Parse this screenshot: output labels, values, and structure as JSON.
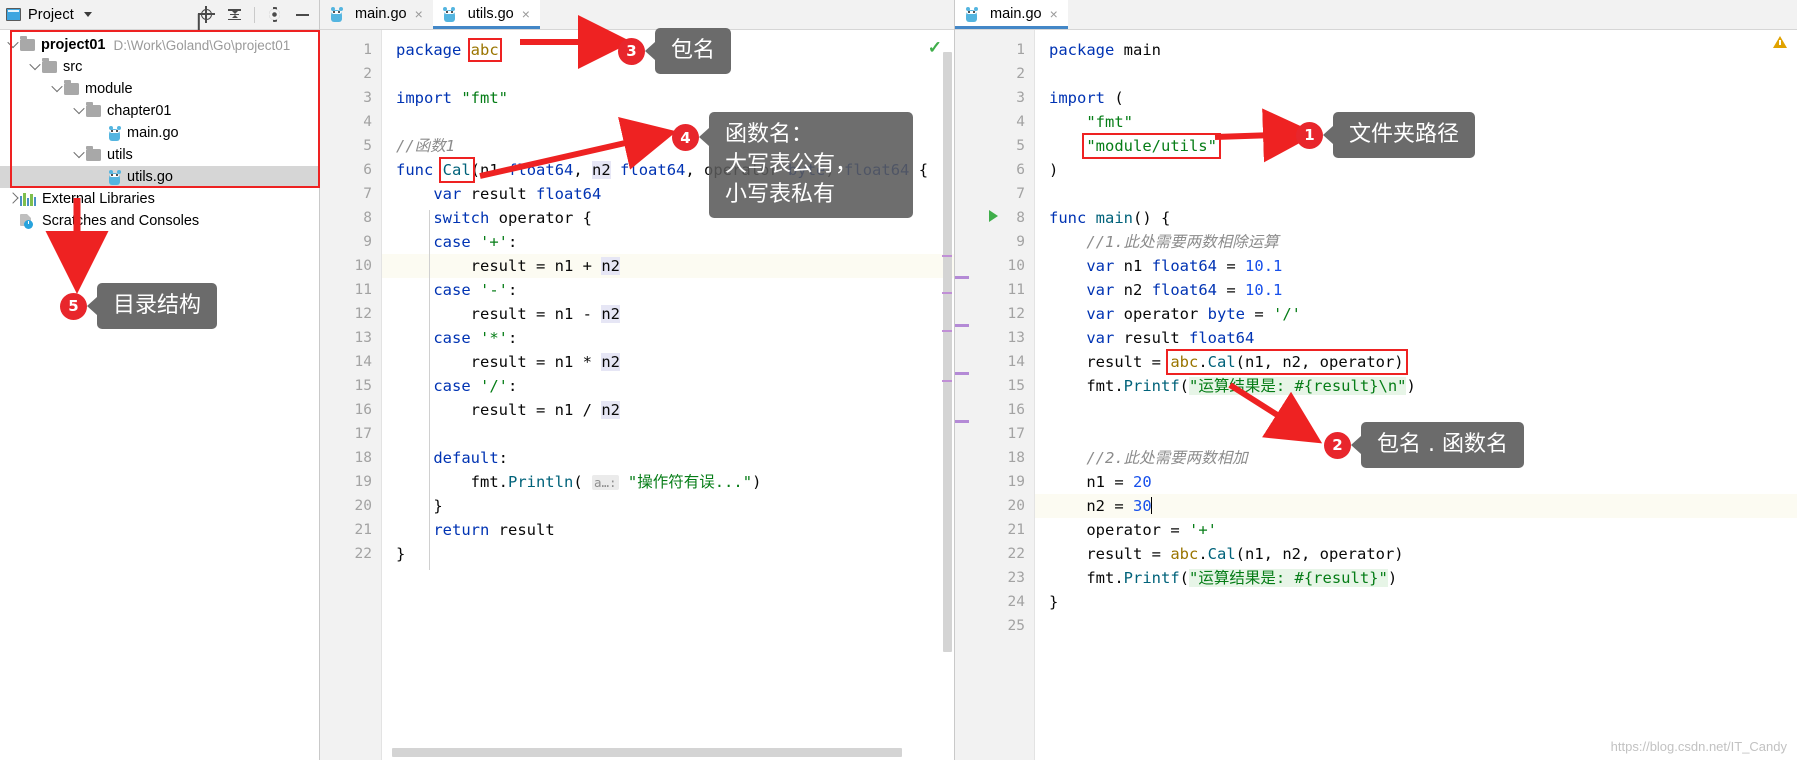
{
  "project_panel": {
    "title": "Project",
    "icons": [
      "project-icon",
      "caret-down-icon",
      "locate-target-icon",
      "collapse-all-icon",
      "settings-gear-icon",
      "minimize-icon"
    ],
    "tree": [
      {
        "label": "project01",
        "path": "D:\\Work\\Goland\\Go\\project01",
        "icon": "folder",
        "expanded": true,
        "depth": 0,
        "bold": true,
        "selected": false
      },
      {
        "label": "src",
        "path": "",
        "icon": "folder",
        "expanded": true,
        "depth": 1,
        "bold": false,
        "selected": false
      },
      {
        "label": "module",
        "path": "",
        "icon": "folder",
        "expanded": true,
        "depth": 2,
        "bold": false,
        "selected": false
      },
      {
        "label": "chapter01",
        "path": "",
        "icon": "folder",
        "expanded": true,
        "depth": 3,
        "bold": false,
        "selected": false
      },
      {
        "label": "main.go",
        "path": "",
        "icon": "go-file",
        "expanded": null,
        "depth": 4,
        "bold": false,
        "selected": false
      },
      {
        "label": "utils",
        "path": "",
        "icon": "folder",
        "expanded": true,
        "depth": 3,
        "bold": false,
        "selected": false
      },
      {
        "label": "utils.go",
        "path": "",
        "icon": "go-file",
        "expanded": null,
        "depth": 4,
        "bold": false,
        "selected": true
      },
      {
        "label": "External Libraries",
        "path": "",
        "icon": "libraries",
        "expanded": false,
        "depth": 0,
        "bold": false,
        "selected": false
      },
      {
        "label": "Scratches and Consoles",
        "path": "",
        "icon": "scratches",
        "expanded": null,
        "depth": 0,
        "bold": false,
        "selected": false
      }
    ]
  },
  "left_editor": {
    "tabs": [
      {
        "label": "main.go",
        "icon": "go-file-icon",
        "active": false,
        "close": "×"
      },
      {
        "label": "utils.go",
        "icon": "go-file-icon",
        "active": true,
        "close": "×"
      }
    ],
    "lines": [
      {
        "n": "1",
        "text": "package abc"
      },
      {
        "n": "2",
        "text": ""
      },
      {
        "n": "3",
        "text": "import \"fmt\""
      },
      {
        "n": "4",
        "text": ""
      },
      {
        "n": "5",
        "text": "//函数1"
      },
      {
        "n": "6",
        "text": "func Cal(n1 float64, n2 float64, operator byte) float64 {"
      },
      {
        "n": "7",
        "text": "    var result float64"
      },
      {
        "n": "8",
        "text": "    switch operator {"
      },
      {
        "n": "9",
        "text": "    case '+':"
      },
      {
        "n": "10",
        "text": "        result = n1 + n2"
      },
      {
        "n": "11",
        "text": "    case '-':"
      },
      {
        "n": "12",
        "text": "        result = n1 - n2"
      },
      {
        "n": "13",
        "text": "    case '*':"
      },
      {
        "n": "14",
        "text": "        result = n1 * n2"
      },
      {
        "n": "15",
        "text": "    case '/':"
      },
      {
        "n": "16",
        "text": "        result = n1 / n2"
      },
      {
        "n": "17",
        "text": ""
      },
      {
        "n": "18",
        "text": "    default:"
      },
      {
        "n": "19",
        "text": "        fmt.Println( a…: \"操作符有误...\")"
      },
      {
        "n": "20",
        "text": "    }"
      },
      {
        "n": "21",
        "text": "    return result"
      },
      {
        "n": "22",
        "text": "}"
      }
    ],
    "highlight_line": "10",
    "hint_arg": "a…:",
    "status_icon": "checkmark-ok-icon"
  },
  "right_editor": {
    "tabs": [
      {
        "label": "main.go",
        "icon": "go-file-icon",
        "active": true,
        "close": "×"
      }
    ],
    "lines": [
      {
        "n": "1",
        "text": "package main"
      },
      {
        "n": "2",
        "text": ""
      },
      {
        "n": "3",
        "text": "import ("
      },
      {
        "n": "4",
        "text": "    \"fmt\""
      },
      {
        "n": "5",
        "text": "    \"module/utils\""
      },
      {
        "n": "6",
        "text": ")"
      },
      {
        "n": "7",
        "text": ""
      },
      {
        "n": "8",
        "text": "func main() {"
      },
      {
        "n": "9",
        "text": "    //1.此处需要两数相除运算"
      },
      {
        "n": "10",
        "text": "    var n1 float64 = 10.1"
      },
      {
        "n": "11",
        "text": "    var n2 float64 = 10.1"
      },
      {
        "n": "12",
        "text": "    var operator byte = '/'"
      },
      {
        "n": "13",
        "text": "    var result float64"
      },
      {
        "n": "14",
        "text": "    result = abc.Cal(n1, n2, operator)"
      },
      {
        "n": "15",
        "text": "    fmt.Printf(\"运算结果是: #{result}\\n\")"
      },
      {
        "n": "16",
        "text": ""
      },
      {
        "n": "17",
        "text": ""
      },
      {
        "n": "18",
        "text": "    //2.此处需要两数相加"
      },
      {
        "n": "19",
        "text": "    n1 = 20"
      },
      {
        "n": "20",
        "text": "    n2 = 30"
      },
      {
        "n": "21",
        "text": "    operator = '+'"
      },
      {
        "n": "22",
        "text": "    result = abc.Cal(n1, n2, operator)"
      },
      {
        "n": "23",
        "text": "    fmt.Printf(\"运算结果是: #{result}\")"
      },
      {
        "n": "24",
        "text": "}"
      },
      {
        "n": "25",
        "text": ""
      }
    ],
    "highlight_line": "20",
    "run_marker_line": "8",
    "status_icon": "warning-triangle-icon"
  },
  "annotations": [
    {
      "id": "1",
      "badge": "1",
      "text": "文件夹路径"
    },
    {
      "id": "2",
      "badge": "2",
      "text": "包名 . 函数名"
    },
    {
      "id": "3",
      "badge": "3",
      "text": "包名"
    },
    {
      "id": "4",
      "badge": "4",
      "text": "函数名：\n大写表公有，\n小写表私有"
    },
    {
      "id": "5",
      "badge": "5",
      "text": "目录结构"
    }
  ],
  "watermark": "https://blog.csdn.net/IT_Candy"
}
